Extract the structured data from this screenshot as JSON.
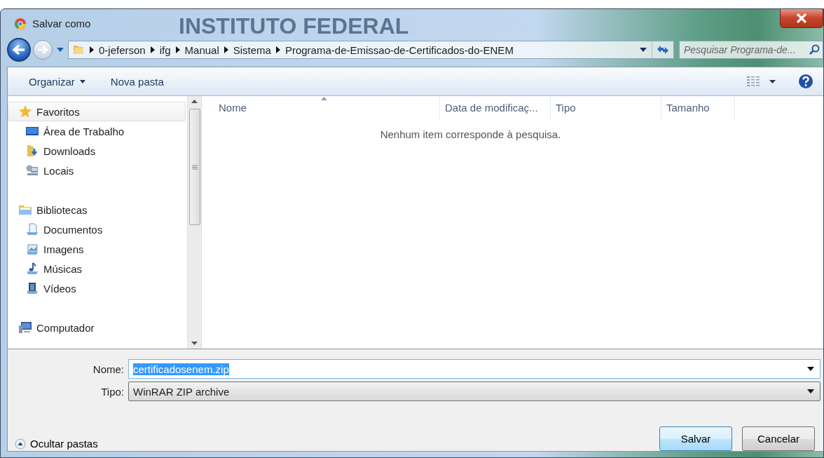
{
  "window": {
    "title": "Salvar como",
    "backdrop_text": "INSTITUTO FEDERAL"
  },
  "address_bar": {
    "path": [
      "0-jeferson",
      "ifg",
      "Manual",
      "Sistema",
      "Programa-de-Emissao-de-Certificados-do-ENEM"
    ]
  },
  "search": {
    "placeholder": "Pesquisar Programa-de..."
  },
  "toolbar": {
    "items": [
      {
        "label": "Organizar",
        "kind": "menu"
      },
      {
        "label": "Nova pasta",
        "kind": "button"
      }
    ]
  },
  "sidebar": {
    "items": [
      {
        "label": "Favoritos",
        "kind": "star",
        "selected": true,
        "children": [
          {
            "label": "Área de Trabalho",
            "kind": "desktop",
            "selected": false
          },
          {
            "label": "Downloads",
            "kind": "downloads",
            "selected": false
          },
          {
            "label": "Locais",
            "kind": "places",
            "selected": false
          }
        ]
      },
      {
        "label": "Bibliotecas",
        "kind": "library",
        "selected": false,
        "children": [
          {
            "label": "Documentos",
            "kind": "documents",
            "selected": false
          },
          {
            "label": "Imagens",
            "kind": "pictures",
            "selected": false
          },
          {
            "label": "Músicas",
            "kind": "music",
            "selected": false
          },
          {
            "label": "Vídeos",
            "kind": "videos",
            "selected": false
          }
        ]
      },
      {
        "label": "Computador",
        "kind": "computer",
        "selected": false
      }
    ]
  },
  "file_list": {
    "columns": [
      {
        "label": "Nome",
        "sorted": true
      },
      {
        "label": "Data de modificaç...",
        "sorted": false
      },
      {
        "label": "Tipo",
        "sorted": false
      },
      {
        "label": "Tamanho",
        "sorted": false
      }
    ],
    "empty_message": "Nenhum item corresponde à pesquisa."
  },
  "form": {
    "name_label": "Nome:",
    "name_value": "certificadosenem.zip",
    "name_value_selected": true,
    "type_label": "Tipo:",
    "type_value": "WinRAR ZIP archive"
  },
  "hide_folders": "Ocultar pastas",
  "buttons": [
    {
      "label": "Salvar",
      "default": true
    },
    {
      "label": "Cancelar",
      "default": false
    }
  ]
}
